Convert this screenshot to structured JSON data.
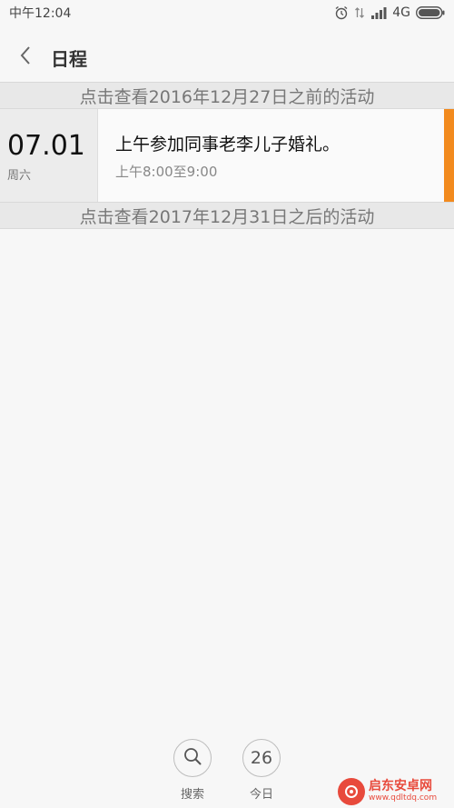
{
  "status_bar": {
    "time": "中午12:04",
    "network": "4G"
  },
  "header": {
    "title": "日程"
  },
  "range_before": {
    "label": "点击查看2016年12月27日之前的活动"
  },
  "range_after": {
    "label": "点击查看2017年12月31日之后的活动"
  },
  "events": [
    {
      "date": "07.01",
      "weekday": "周六",
      "title": "上午参加同事老李儿子婚礼。",
      "time": "上午8:00至9:00",
      "accent_color": "#f28a1e"
    }
  ],
  "toolbar": {
    "search_label": "搜索",
    "today_number": "26",
    "today_label": "今日"
  },
  "watermark": {
    "title": "启东安卓网",
    "url": "www.qdltdq.com"
  }
}
